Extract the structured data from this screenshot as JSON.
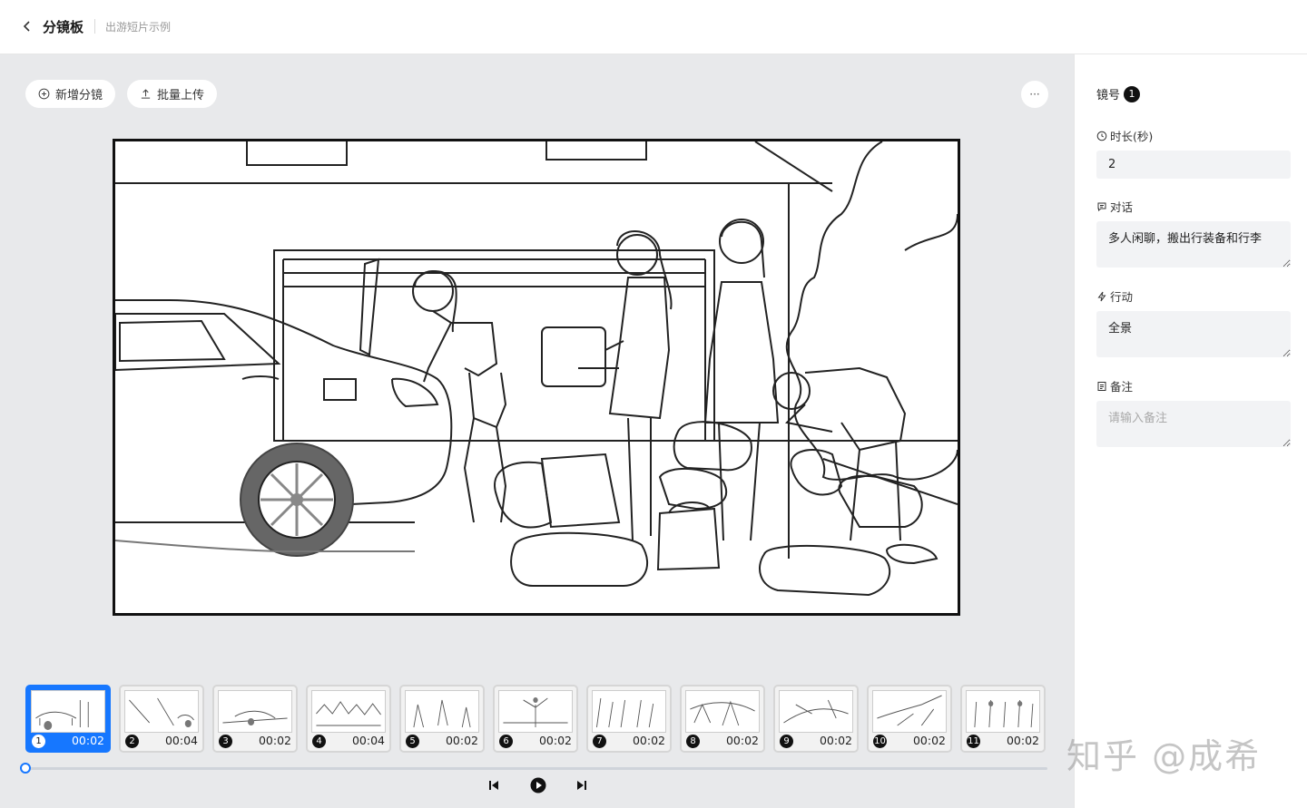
{
  "header": {
    "title": "分镜板",
    "subtitle": "出游短片示例"
  },
  "toolbar": {
    "add_label": "新增分镜",
    "upload_label": "批量上传",
    "more_label": "···"
  },
  "shots": [
    {
      "num": "1",
      "duration": "00:02",
      "active": true
    },
    {
      "num": "2",
      "duration": "00:04",
      "active": false
    },
    {
      "num": "3",
      "duration": "00:02",
      "active": false
    },
    {
      "num": "4",
      "duration": "00:04",
      "active": false
    },
    {
      "num": "5",
      "duration": "00:02",
      "active": false
    },
    {
      "num": "6",
      "duration": "00:02",
      "active": false
    },
    {
      "num": "7",
      "duration": "00:02",
      "active": false
    },
    {
      "num": "8",
      "duration": "00:02",
      "active": false
    },
    {
      "num": "9",
      "duration": "00:02",
      "active": false
    },
    {
      "num": "10",
      "duration": "00:02",
      "active": false
    },
    {
      "num": "11",
      "duration": "00:02",
      "active": false
    }
  ],
  "panel": {
    "shot_label": "镜号",
    "shot_number": "1",
    "duration_label": "时长(秒)",
    "duration_value": "2",
    "dialogue_label": "对话",
    "dialogue_value": "多人闲聊，搬出行装备和行李",
    "action_label": "行动",
    "action_value": "全景",
    "notes_label": "备注",
    "notes_placeholder": "请输入备注"
  },
  "watermark": "知乎 @成希",
  "colors": {
    "accent": "#1677ff",
    "canvas_bg": "#e8e9eb"
  }
}
